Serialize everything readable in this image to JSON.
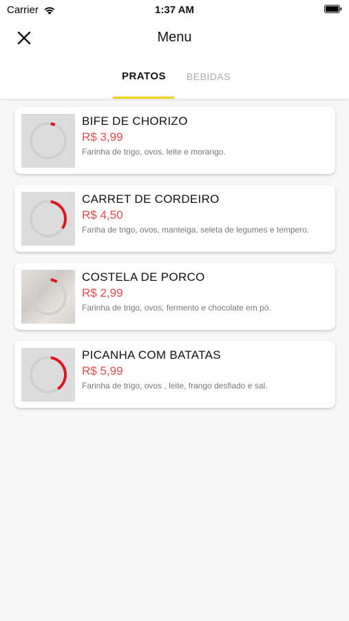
{
  "status_bar": {
    "carrier": "Carrier",
    "time": "1:37 AM",
    "wifi_icon": "wifi-icon",
    "battery_icon": "battery-icon"
  },
  "header": {
    "title": "Menu",
    "close_icon": "close-icon"
  },
  "tabs": [
    {
      "label": "PRATOS",
      "active": true
    },
    {
      "label": "BEBIDAS",
      "active": false
    }
  ],
  "colors": {
    "accent": "#f5d113",
    "price": "#e34b4b",
    "spinner": "#e0141e"
  },
  "items": [
    {
      "name": "BIFE DE CHORIZO",
      "price": "R$ 3,99",
      "description": "Farinha de trigo, ovos, leite e morango.",
      "image_loading": 0.04
    },
    {
      "name": "CARRET DE CORDEIRO",
      "price": "R$ 4,50",
      "description": "Fariha de trigo, ovos, manteiga, seleta de legumes e tempero.",
      "image_loading": 0.32
    },
    {
      "name": "COSTELA DE PORCO",
      "price": "R$ 2,99",
      "description": "Farinha de trigo, ovos, fermento e chocolate em pó.",
      "image_loading": 0.06
    },
    {
      "name": "PICANHA COM BATATAS",
      "price": "R$ 5,99",
      "description": "Farinha de trigo, ovos , leite, frango desfiado e sal.",
      "image_loading": 0.38
    }
  ]
}
